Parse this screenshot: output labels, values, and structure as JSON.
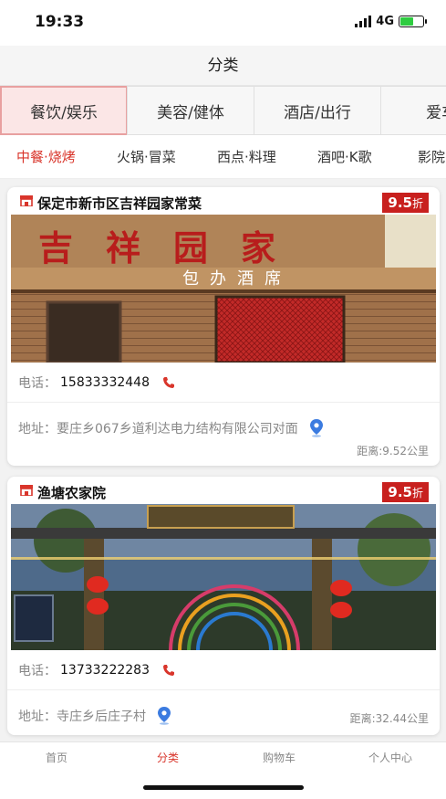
{
  "status_bar": {
    "time": "19:33",
    "network": "4G",
    "battery_level": 0.6
  },
  "header": {
    "title": "分类"
  },
  "category_tabs": [
    {
      "label": "餐饮/娱乐",
      "active": true
    },
    {
      "label": "美容/健体",
      "active": false
    },
    {
      "label": "酒店/出行",
      "active": false
    },
    {
      "label": "爱车/",
      "active": false
    }
  ],
  "sub_tabs": [
    {
      "label": "中餐·烧烤",
      "active": true
    },
    {
      "label": "火锅·冒菜",
      "active": false
    },
    {
      "label": "西点·料理",
      "active": false
    },
    {
      "label": "酒吧·K歌",
      "active": false
    },
    {
      "label": "影院·",
      "active": false
    }
  ],
  "shops": [
    {
      "name": "保定市新市区吉祥园家常菜",
      "discount": "9.5",
      "discount_unit": "折",
      "phone_label": "电话：",
      "phone": "15833332448",
      "address_label": "地址：",
      "address": "要庄乡067乡道利达电力结构有限公司对面",
      "distance": "距离:9.52公里",
      "sign_text": "吉祥园家",
      "sign_subtext": "包办酒席",
      "image_icon": "restaurant-storefront"
    },
    {
      "name": "渔塘农家院",
      "discount": "9.5",
      "discount_unit": "折",
      "phone_label": "电话：",
      "phone": "13733222283",
      "address_label": "地址：",
      "address": "寺庄乡后庄子村",
      "distance": "距离:32.44公里",
      "image_icon": "farmhouse-gate"
    }
  ],
  "tab_bar": [
    {
      "label": "首页",
      "active": false
    },
    {
      "label": "分类",
      "active": true
    },
    {
      "label": "购物车",
      "active": false
    },
    {
      "label": "个人中心",
      "active": false
    }
  ],
  "colors": {
    "accent": "#d9352b",
    "discount_bg": "#c8201e",
    "active_tab_bg": "#fbe6e6",
    "pin": "#3b7be0"
  }
}
